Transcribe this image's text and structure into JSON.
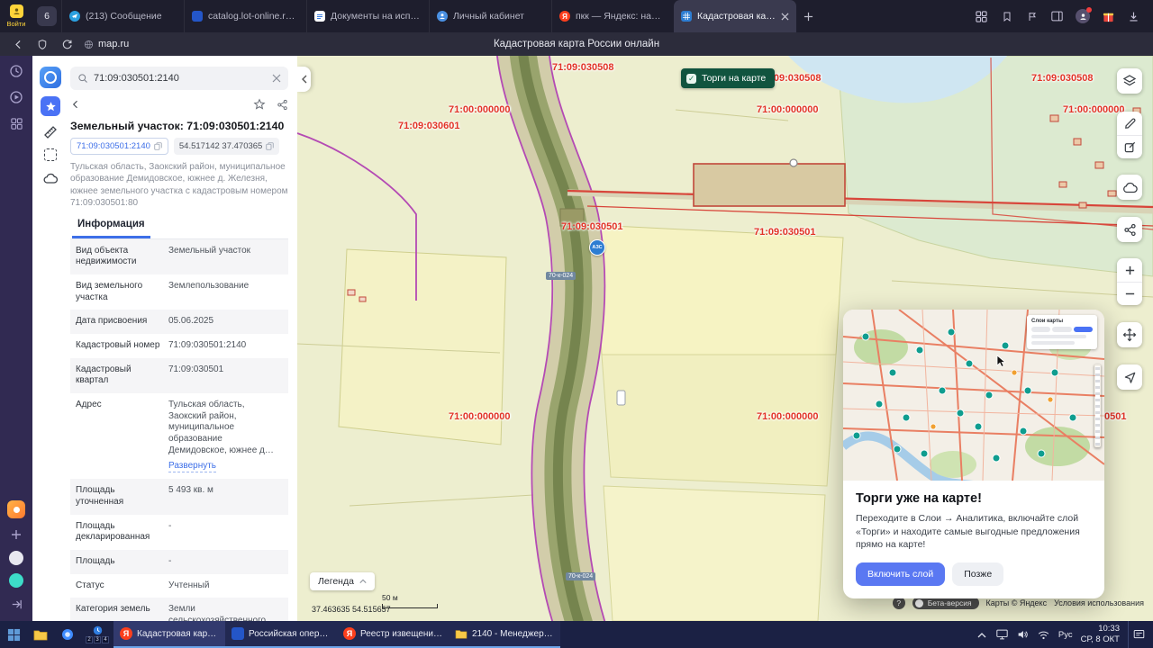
{
  "browser": {
    "profile_label": "Войти",
    "tab_counter": "6",
    "yandex_letter": "Я",
    "tabs": [
      {
        "title": "(213) Сообщение"
      },
      {
        "title": "catalog.lot-online.ru/inde…"
      },
      {
        "title": "Документы на исполнен…"
      },
      {
        "title": "Личный кабинет"
      },
      {
        "title": "пкк — Яндекс: нашлось…"
      },
      {
        "title": "Кадастровая карта Рос…"
      }
    ],
    "address": "map.ru",
    "page_title": "Кадастровая карта России онлайн"
  },
  "panel": {
    "search_value": "71:09:030501:2140",
    "title": "Земельный участок: 71:09:030501:2140",
    "chips": {
      "cadastral": "71:09:030501:2140",
      "coordinates": "54.517142 37.470365"
    },
    "description": "Тульская область, Заокский район, муниципальное образование Демидовское, южнее д. Железня, южнее земельного участка с кадастровым номером 71:09:030501:80",
    "tab_info": "Информация",
    "expand_link": "Развернуть",
    "rows": [
      {
        "label": "Вид объекта недвижимости",
        "value": "Земельный участок"
      },
      {
        "label": "Вид земельного участка",
        "value": "Землепользование"
      },
      {
        "label": "Дата присвоения",
        "value": "05.06.2025"
      },
      {
        "label": "Кадастровый номер",
        "value": "71:09:030501:2140"
      },
      {
        "label": "Кадастровый квартал",
        "value": "71:09:030501"
      },
      {
        "label": "Адрес",
        "value": "Тульская область, Заокский район, муниципальное образование Демидовское, южнее д…"
      },
      {
        "label": "Площадь уточненная",
        "value": "5 493 кв. м"
      },
      {
        "label": "Площадь декларированная",
        "value": "-"
      },
      {
        "label": "Площадь",
        "value": "-"
      },
      {
        "label": "Статус",
        "value": "Учтенный"
      },
      {
        "label": "Категория земель",
        "value": "Земли сельскохозяйственного назначения"
      }
    ]
  },
  "map": {
    "torgi_toggle": "Торги на карте",
    "labels": [
      {
        "text": "71:09:030508"
      },
      {
        "text": "71:09:030508"
      },
      {
        "text": "71:09:030508"
      },
      {
        "text": "71:00:000000"
      },
      {
        "text": "71:00:000000"
      },
      {
        "text": "71:00:000000"
      },
      {
        "text": "71:09:030601"
      },
      {
        "text": "71:09:030501"
      },
      {
        "text": "71:09:030501"
      },
      {
        "text": "71:00:000000"
      },
      {
        "text": "71:00:000000"
      },
      {
        "text": "71:09:030501"
      }
    ],
    "road_badge": "70-к-024",
    "station_label": "АЗС",
    "legend_button": "Легенда",
    "status_coordinates": "37.463635 54.515657",
    "scale_label": "50 м",
    "help_label": "?",
    "beta_label": "Бета-версия",
    "attribution": "Карты © Яндекс",
    "terms_link": "Условия использования"
  },
  "popup": {
    "layers_panel_title": "Слои карты",
    "title": "Торги уже на карте!",
    "body": "Переходите в Слои → Аналитика, включайте слой «Торги» и находите самые выгодные предложения прямо на карте!",
    "enable_button": "Включить слой",
    "later_button": "Позже"
  },
  "taskbar": {
    "apps": [
      {
        "label": "Кадастровая кар…"
      },
      {
        "label": "Российская опер…"
      },
      {
        "label": "Реестр извещени…"
      },
      {
        "label": "2140 - Менеджер…"
      }
    ],
    "badges": [
      "2",
      "3",
      "4"
    ],
    "language": "Рус",
    "time": "10:33",
    "date": "СР, 8 ОКТ"
  },
  "colors": {
    "accent_blue": "#5a78f2",
    "cadastral_label_red": "#e23327",
    "boundary_magenta": "#b44ab4",
    "boundary_red": "#d8453a",
    "torgi_pill_green": "#11543f",
    "yandex_red": "#fc3f1d",
    "profile_yellow": "#ffd43a"
  }
}
